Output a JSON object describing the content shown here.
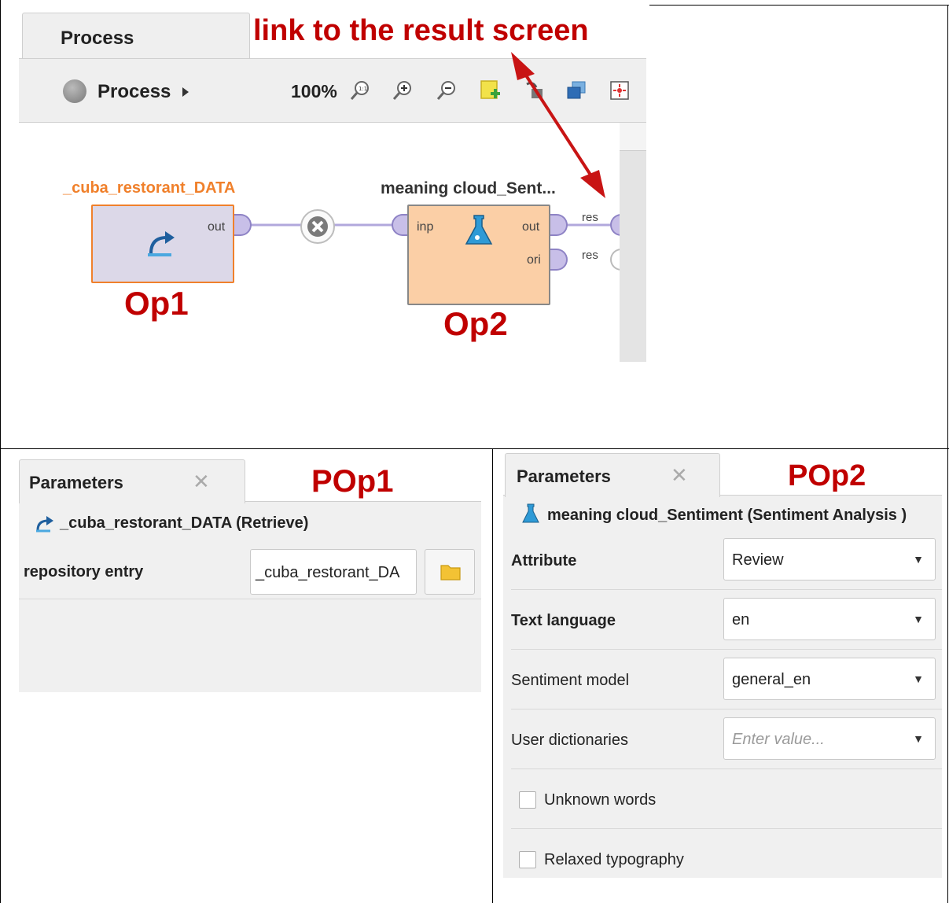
{
  "process_panel": {
    "tab_label": "Process",
    "breadcrumb": "Process",
    "zoom_level": "100%",
    "annotation": "link to the result screen",
    "operators": [
      {
        "title": "_cuba_restorant_DATA",
        "label": "Op1",
        "ports_out": [
          "out"
        ]
      },
      {
        "title": "meaning cloud_Sent...",
        "label": "Op2",
        "ports_in": [
          "inp"
        ],
        "ports_out": [
          "out",
          "ori"
        ]
      }
    ],
    "result_ports": [
      "res",
      "res"
    ]
  },
  "params_op1": {
    "tab_label": "Parameters",
    "annotation": "POp1",
    "operator_title": "_cuba_restorant_DATA (Retrieve)",
    "repository_label": "repository entry",
    "repository_value": "_cuba_restorant_DA"
  },
  "params_op2": {
    "tab_label": "Parameters",
    "annotation": "POp2",
    "operator_title": "meaning cloud_Sentiment (Sentiment Analysis )",
    "fields": [
      {
        "label": "Attribute",
        "value": "Review"
      },
      {
        "label": "Text language",
        "value": "en"
      },
      {
        "label": "Sentiment model",
        "value": "general_en"
      },
      {
        "label": "User dictionaries",
        "placeholder": "Enter value..."
      }
    ],
    "checkboxes": [
      {
        "label": "Unknown words",
        "checked": false
      },
      {
        "label": "Relaxed typography",
        "checked": false
      }
    ]
  },
  "colors": {
    "annotation_red": "#c00000",
    "op1_border": "#f0802b",
    "op1_fill": "#dcd8e8",
    "op2_fill": "#fbcfa6",
    "op1_title": "#f0802b"
  }
}
